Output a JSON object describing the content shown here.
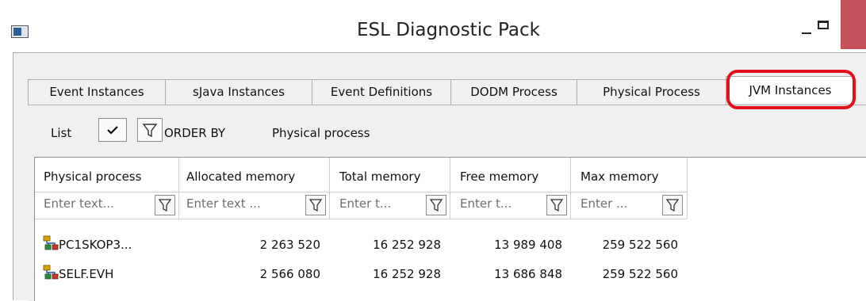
{
  "window": {
    "title": "ESL Diagnostic Pack",
    "colors": {
      "close_button": "#c7515a",
      "highlight": "#e3101c"
    }
  },
  "tabs": [
    {
      "label": "Event Instances",
      "active": false
    },
    {
      "label": "sJava Instances",
      "active": false
    },
    {
      "label": "Event Definitions",
      "active": false
    },
    {
      "label": "DODM Process",
      "active": false
    },
    {
      "label": "Physical Process",
      "active": false
    },
    {
      "label": "JVM Instances",
      "active": true
    }
  ],
  "toolbar": {
    "list_label": "List",
    "check_icon": "checkmark-icon",
    "filter_icon": "funnel-icon",
    "order_by_label": "ORDER BY",
    "order_by_value": "Physical process"
  },
  "grid": {
    "columns": [
      {
        "header": "Physical process",
        "placeholder": "Enter text..."
      },
      {
        "header": "Allocated memory",
        "placeholder": "Enter text ..."
      },
      {
        "header": "Total memory",
        "placeholder": "Enter t..."
      },
      {
        "header": "Free memory",
        "placeholder": "Enter t..."
      },
      {
        "header": "Max memory",
        "placeholder": "Enter ..."
      }
    ],
    "rows": [
      {
        "process": "PC1SKOP3...",
        "allocated": "2 263 520",
        "total": "16 252 928",
        "free": "13 989 408",
        "max": "259 522 560"
      },
      {
        "process": "SELF.EVH",
        "allocated": "2 566 080",
        "total": "16 252 928",
        "free": "13 686 848",
        "max": "259 522 560"
      }
    ]
  }
}
